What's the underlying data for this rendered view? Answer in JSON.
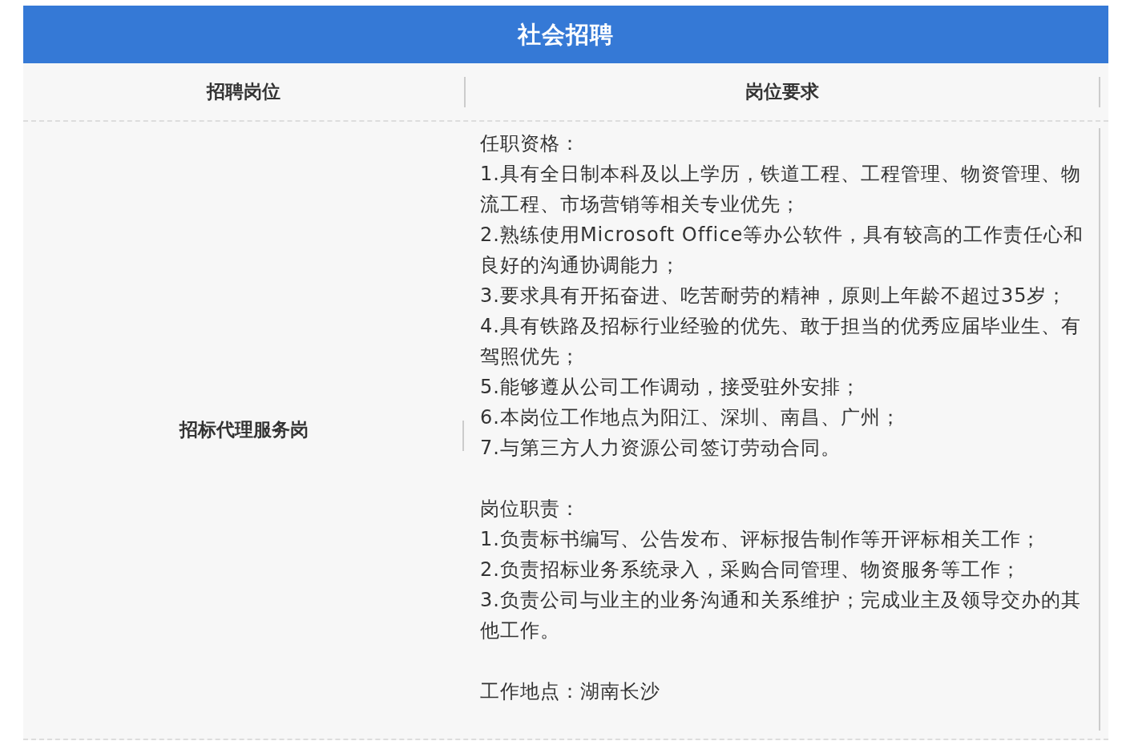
{
  "title": "社会招聘",
  "columns": [
    "招聘岗位",
    "岗位要求"
  ],
  "rows": [
    {
      "position": "招标代理服务岗",
      "sections": [
        {
          "heading": "任职资格：",
          "lines": [
            "1.具有全日制本科及以上学历，铁道工程、工程管理、物资管理、物流工程、市场营销等相关专业优先；",
            "2.熟练使用Microsoft Office等办公软件，具有较高的工作责任心和良好的沟通协调能力；",
            "3.要求具有开拓奋进、吃苦耐劳的精神，原则上年龄不超过35岁；",
            "4.具有铁路及招标行业经验的优先、敢于担当的优秀应届毕业生、有驾照优先；",
            "5.能够遵从公司工作调动，接受驻外安排；",
            "6.本岗位工作地点为阳江、深圳、南昌、广州；",
            "7.与第三方人力资源公司签订劳动合同。"
          ]
        },
        {
          "heading": "岗位职责：",
          "lines": [
            "1.负责标书编写、公告发布、评标报告制作等开评标相关工作；",
            "2.负责招标业务系统录入，采购合同管理、物资服务等工作；",
            "3.负责公司与业主的业务沟通和关系维护；完成业主及领导交办的其他工作。"
          ]
        },
        {
          "heading": "工作地点：湖南长沙"
        }
      ]
    }
  ]
}
